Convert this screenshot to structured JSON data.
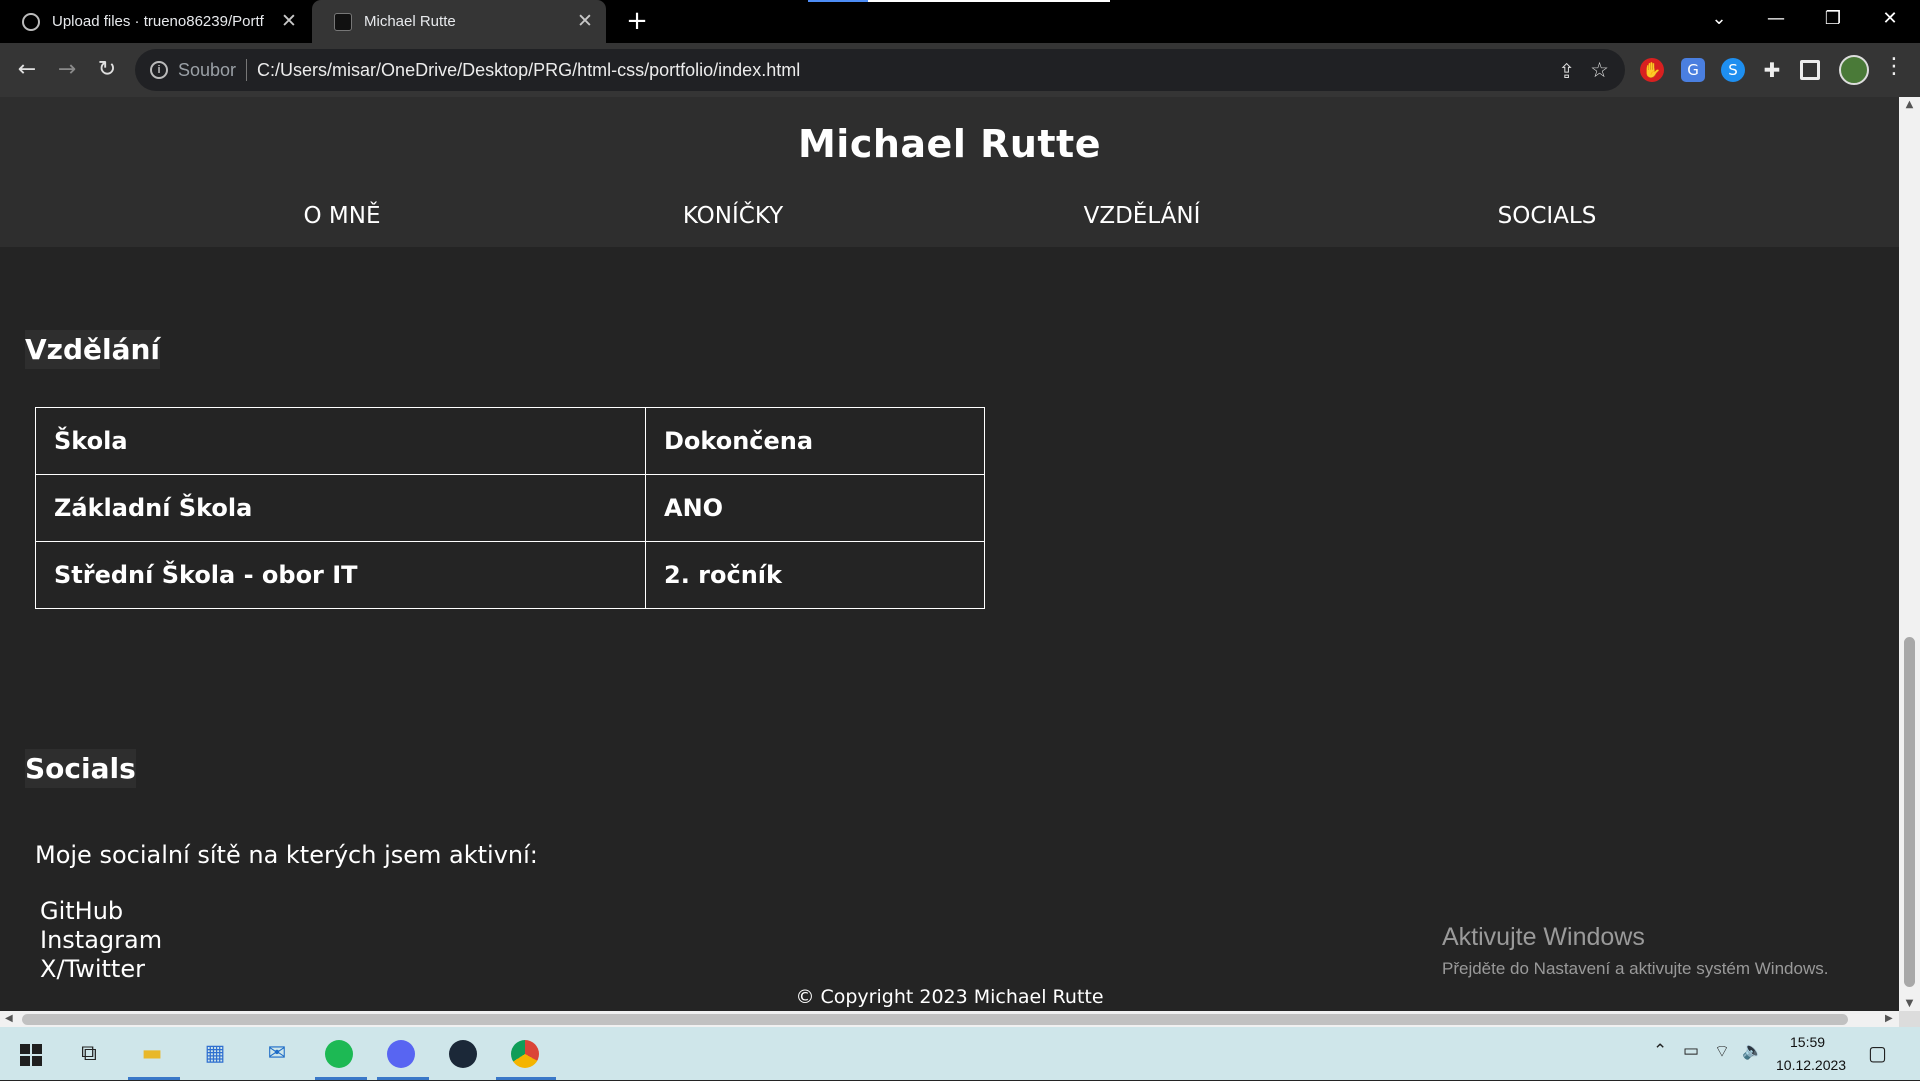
{
  "browser": {
    "tabs": [
      {
        "title": "Upload files · trueno86239/Portf",
        "active": false
      },
      {
        "title": "Michael Rutte",
        "active": true
      }
    ],
    "address": {
      "scheme_label": "Soubor",
      "url": "C:/Users/misar/OneDrive/Desktop/PRG/html-css/portfolio/index.html"
    },
    "icons": {
      "back": "arrow-left-icon",
      "forward": "arrow-right-icon",
      "reload": "reload-icon",
      "info": "info-icon",
      "share": "share-icon",
      "bookmark": "star-icon",
      "extensions": [
        "red-hand-extension-icon",
        "google-translate-extension-icon",
        "shazam-extension-icon",
        "puzzle-extensions-icon",
        "side-panel-icon"
      ],
      "profile": "profile-avatar",
      "menu": "three-dots-menu-icon"
    }
  },
  "page": {
    "site_title": "Michael Rutte",
    "nav": [
      "O MNĚ",
      "KONÍČKY",
      "VZDĚLÁNÍ",
      "SOCIALS"
    ],
    "education": {
      "heading": "Vzdělání",
      "table": {
        "header": [
          "Škola",
          "Dokončena"
        ],
        "rows": [
          [
            "Základní Škola",
            "ANO"
          ],
          [
            "Střední Škola - obor IT",
            "2. ročník"
          ]
        ]
      }
    },
    "socials": {
      "heading": "Socials",
      "intro": "Moje socialní sítě na kterých jsem aktivní:",
      "links": [
        "GitHub",
        "Instagram",
        "X/Twitter"
      ]
    },
    "footer": "© Copyright 2023 Michael Rutte"
  },
  "watermark": {
    "title": "Aktivujte Windows",
    "subtitle": "Přejděte do Nastavení a aktivujte systém Windows."
  },
  "taskbar": {
    "apps": [
      "start-icon",
      "task-view-icon",
      "file-explorer-icon",
      "microsoft-store-icon",
      "mail-icon",
      "spotify-icon",
      "discord-icon",
      "steam-icon",
      "chrome-icon"
    ],
    "clock": {
      "time": "15:59",
      "date": "10.12.2023"
    }
  }
}
